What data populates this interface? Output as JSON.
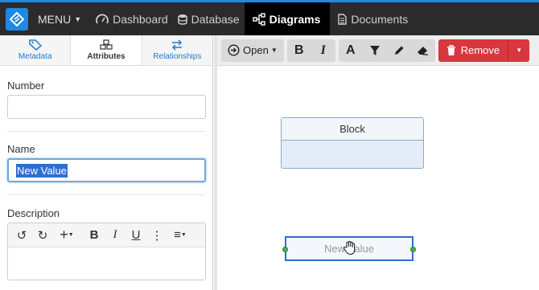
{
  "nav": {
    "menu_label": "MENU",
    "items": [
      {
        "label": "Dashboard"
      },
      {
        "label": "Database"
      },
      {
        "label": "Diagrams"
      },
      {
        "label": "Documents"
      }
    ]
  },
  "left_panel": {
    "tabs": [
      {
        "label": "Metadata"
      },
      {
        "label": "Attributes"
      },
      {
        "label": "Relationships"
      }
    ],
    "fields": {
      "number_label": "Number",
      "number_value": "",
      "name_label": "Name",
      "name_value": "New Value",
      "description_label": "Description"
    },
    "editor_buttons": [
      "↺",
      "↻",
      "+",
      "B",
      "I",
      "U",
      "⋮",
      "≡"
    ]
  },
  "toolbar": {
    "open_label": "Open",
    "bold": "B",
    "italic": "I",
    "font": "A",
    "remove_label": "Remove"
  },
  "diagram": {
    "block_title": "Block",
    "selected_node_text": "New Value"
  }
}
